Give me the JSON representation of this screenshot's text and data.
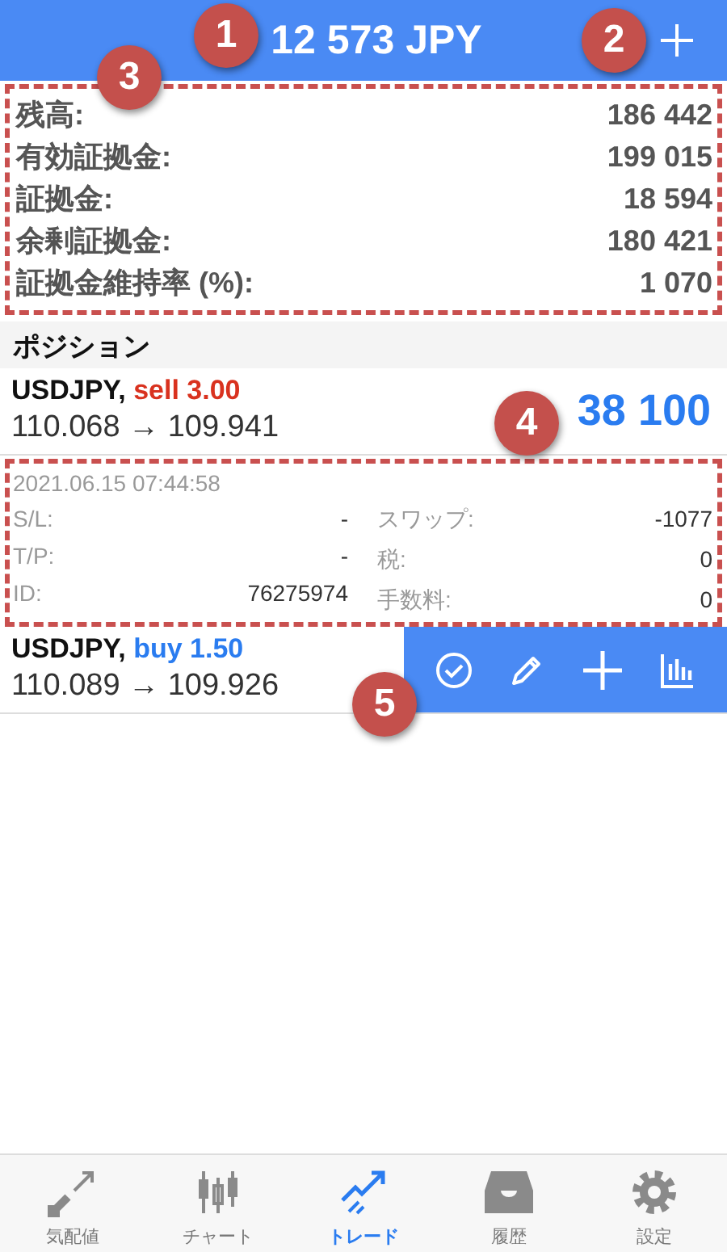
{
  "header": {
    "title": "12 573 JPY"
  },
  "summary": [
    {
      "label": "残高:",
      "value": "186 442"
    },
    {
      "label": "有効証拠金:",
      "value": "199 015"
    },
    {
      "label": "証拠金:",
      "value": "18 594"
    },
    {
      "label": "余剰証拠金:",
      "value": "180 421"
    },
    {
      "label": "証拠金維持率 (%):",
      "value": "1 070"
    }
  ],
  "section_title": "ポジション",
  "positions": [
    {
      "symbol": "USDJPY,",
      "side_text": "sell 3.00",
      "color": "#d9321f",
      "prices": "110.068 → 109.941",
      "profit": "38 100",
      "actions_shown": false,
      "details": {
        "time": "2021.06.15 07:44:58",
        "columns": [
          [
            {
              "label": "S/L:",
              "value": "-"
            },
            {
              "label": "T/P:",
              "value": "-"
            },
            {
              "label": "ID:",
              "value": "76275974"
            }
          ],
          [
            {
              "label": "スワップ:",
              "value": "-1077"
            },
            {
              "label": "税:",
              "value": "0"
            },
            {
              "label": "手数料:",
              "value": "0"
            }
          ]
        ]
      }
    },
    {
      "symbol": "USDJPY,",
      "side_text": "buy 1.50",
      "color": "#2a7cf0",
      "prices": "110.089 → 109.926",
      "actions_shown": true
    }
  ],
  "tabs": [
    {
      "label": "気配値",
      "kind": "quotes",
      "selected": false
    },
    {
      "label": "チャート",
      "kind": "chart",
      "selected": false
    },
    {
      "label": "トレード",
      "kind": "trade",
      "selected": true
    },
    {
      "label": "履歴",
      "kind": "history",
      "selected": false
    },
    {
      "label": "設定",
      "kind": "settings",
      "selected": false
    }
  ],
  "callouts": [
    {
      "number": "1"
    },
    {
      "number": "2"
    },
    {
      "number": "3"
    },
    {
      "number": "4"
    },
    {
      "number": "5"
    }
  ]
}
